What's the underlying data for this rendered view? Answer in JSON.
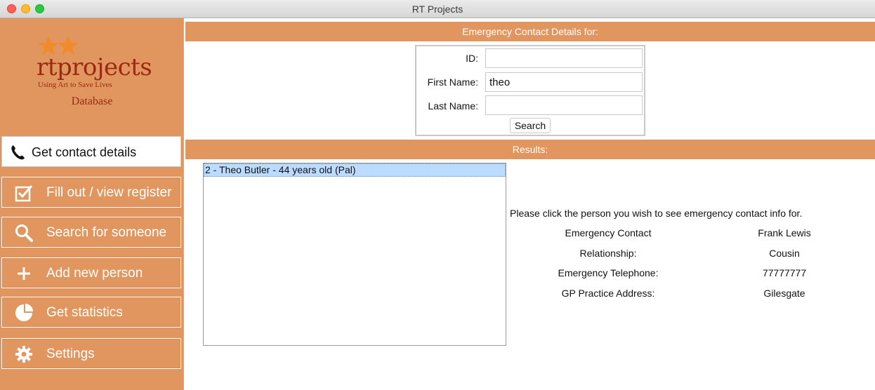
{
  "window": {
    "title": "RT Projects"
  },
  "logo": {
    "wordmark": "rtprojects",
    "tagline": "Using Art to Save Lives",
    "subtitle": "Database",
    "accent_color": "#9a2a14"
  },
  "sidebar": {
    "background": "#e0965e",
    "items": [
      {
        "label": "Get contact details",
        "icon": "phone-icon",
        "active": true
      },
      {
        "label": "Fill out / view register",
        "icon": "checkbox-icon",
        "active": false
      },
      {
        "label": "Search for someone",
        "icon": "search-icon",
        "active": false
      },
      {
        "label": "Add new person",
        "icon": "plus-icon",
        "active": false
      },
      {
        "label": "Get statistics",
        "icon": "pie-chart-icon",
        "active": false
      },
      {
        "label": "Settings",
        "icon": "gear-icon",
        "active": false
      }
    ]
  },
  "main": {
    "header_title": "Emergency Contact Details for:",
    "search": {
      "id_label": "ID:",
      "id_value": "",
      "first_name_label": "First Name:",
      "first_name_value": "theo",
      "last_name_label": "Last Name:",
      "last_name_value": "",
      "button_label": "Search"
    },
    "results_title": "Results:",
    "results": [
      {
        "text": "2 - Theo Butler - 44 years old (Pal)",
        "selected": true
      }
    ],
    "instructions": "Please click the person you wish to see emergency contact info for.",
    "details": [
      {
        "label": "Emergency Contact",
        "value": "Frank Lewis"
      },
      {
        "label": "Relationship:",
        "value": "Cousin"
      },
      {
        "label": "Emergency Telephone:",
        "value": "77777777"
      },
      {
        "label": "GP Practice Address:",
        "value": "Gilesgate"
      }
    ]
  }
}
